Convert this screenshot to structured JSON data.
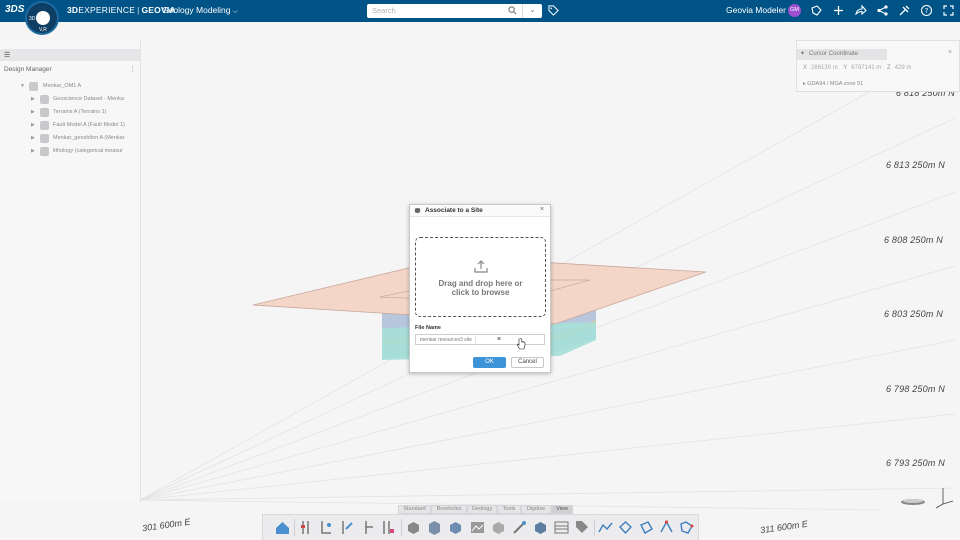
{
  "topbar": {
    "brand_bold": "3D",
    "brand_light": "EXPERIENCE",
    "brand_sep": "|",
    "brand_product": "GEOVIA",
    "app_name": "Geology Modeling",
    "search_placeholder": "Search",
    "user_name": "Geovia Modeler",
    "avatar_initials": "GM",
    "compass_labels": [
      "3D",
      "V,R"
    ]
  },
  "left_panel": {
    "title": "Design Manager",
    "tree": [
      {
        "label": "Menkar_OM1 A",
        "level": 0
      },
      {
        "label": "Geoscience Dataset - Menka",
        "level": 1
      },
      {
        "label": "Terrains A (Terrains 1)",
        "level": 1
      },
      {
        "label": "Fault Model A (Fault Model 1)",
        "level": 1
      },
      {
        "label": "Menkar_geoshifon A (Menkar",
        "level": 1
      },
      {
        "label": "lithology (categorical measur",
        "level": 1
      }
    ]
  },
  "right_panel": {
    "title": "Cursor Coordinate",
    "x_label": "X",
    "x_value": "286130 m",
    "y_label": "Y",
    "y_value": "6797141 m",
    "z_label": "Z",
    "z_value": "429 m",
    "crs": "GDA94 / MGA zone 51"
  },
  "viewport": {
    "northings": [
      "6 818 250m N",
      "6 813 250m N",
      "6 808 250m N",
      "6 803 250m N",
      "6 798 250m N",
      "6 793 250m N"
    ],
    "eastings": [
      "301 600m E",
      "311 600m E"
    ]
  },
  "dialog": {
    "title": "Associate to a Site",
    "drop_text_line1": "Drag and drop here or",
    "drop_text_line2": "click to browse",
    "file_name_label": "File Name",
    "file_chip": "menkar resources3 site",
    "ok_label": "OK",
    "cancel_label": "Cancel"
  },
  "bottom_tabs": [
    "Standard",
    "Boreholes",
    "Geology",
    "Tools",
    "Digitize",
    "View"
  ],
  "active_tab": "View",
  "colors": {
    "topbar": "#005386",
    "ok_button": "#3d93d8",
    "avatar": "#9c4fd0",
    "surface": "#f3d6c8"
  }
}
